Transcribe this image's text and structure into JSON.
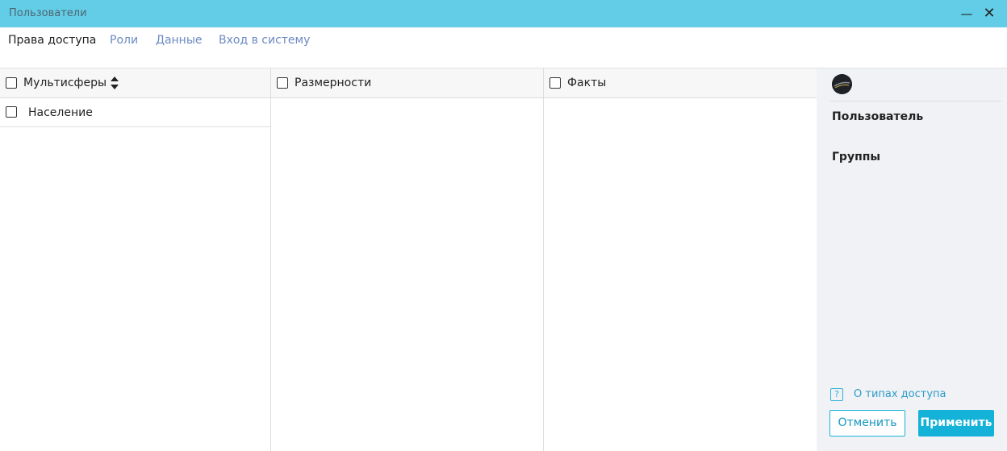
{
  "window": {
    "title": "Пользователи",
    "minimize_glyph": "—",
    "close_glyph": "✕"
  },
  "tabs": [
    {
      "label": "Права доступа",
      "active": true
    },
    {
      "label": "Роли",
      "active": false
    },
    {
      "label": "Данные",
      "active": false
    },
    {
      "label": "Вход в систему",
      "active": false
    }
  ],
  "columns": {
    "multispheres": {
      "header": "Мультисферы",
      "rows": [
        {
          "label": "Население",
          "checked": false
        }
      ]
    },
    "dimensions": {
      "header": "Размерности",
      "rows": []
    },
    "facts": {
      "header": "Факты",
      "rows": []
    }
  },
  "sidebar": {
    "avatar_icon": "user-avatar-icon",
    "user_label": "Пользователь",
    "groups_label": "Группы",
    "help": {
      "icon_glyph": "?",
      "text": "О типах доступа"
    }
  },
  "buttons": {
    "cancel": "Отменить",
    "apply": "Применить"
  },
  "colors": {
    "titlebar": "#63cde8",
    "accent": "#14b2d8",
    "link": "#6b8ac2",
    "sidebar_bg": "#f0f2f5"
  }
}
